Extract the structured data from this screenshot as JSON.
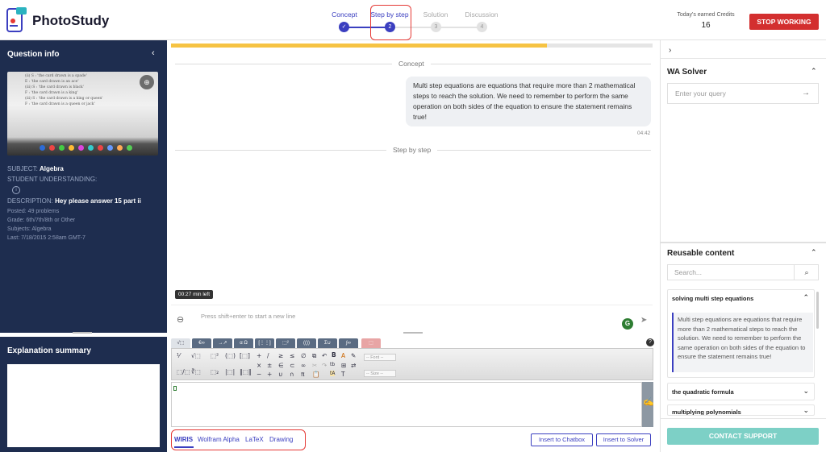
{
  "app": {
    "name": "PhotoStudy"
  },
  "steps": [
    {
      "label": "Concept",
      "state": "done",
      "icon": "check-icon"
    },
    {
      "label": "Step by step",
      "number": "2",
      "state": "active"
    },
    {
      "label": "Solution",
      "number": "3",
      "state": "pending"
    },
    {
      "label": "Discussion",
      "number": "4",
      "state": "pending"
    }
  ],
  "credits": {
    "label": "Today's earned Credits",
    "value": "16"
  },
  "stop_button": "STOP WORKING",
  "question_info": {
    "title": "Question info",
    "image_lines": [
      "(ii) S : 'the card drawn is a spade'",
      "E : 'the card drawn is an ace'",
      "(iii) S : 'the card drawn is black'",
      "F : 'the card drawn is a king'",
      "(iii) S : 'the card drawn is a king or queen'",
      "F : 'the card drawn is a queen or jack'"
    ],
    "subject_label": "SUBJECT:",
    "subject_value": "Algebra",
    "understanding_label": "STUDENT UNDERSTANDING:",
    "description_label": "DESCRIPTION:",
    "description_value": "Hey please answer 15 part ii",
    "posted": "Posted: 49 problems",
    "grade": "Grade: 6th/7th/8th or Other",
    "subjects": "Subjects: Algebra",
    "last": "Last: 7/18/2015 2:58am GMT-7"
  },
  "explanation": {
    "title": "Explanation summary"
  },
  "chat": {
    "section_concept": "Concept",
    "concept_message": "Multi step equations are equations that require more than 2 mathematical steps to reach the solution. We need to remember to perform the same operation on both sides of the equation to ensure the statement remains true!",
    "message_time": "04:42",
    "section_step": "Step by step",
    "timer": "00:27 min left",
    "input_placeholder": "Press shift+enter to start a new line",
    "progress_percent": 78
  },
  "editor": {
    "tabs": [
      "√⬚",
      "€∞",
      "→↗",
      "α Ω",
      "[⋮⋮]",
      "⬚²",
      "(())",
      "Σ∪",
      "∫∞",
      "⬚"
    ],
    "font_dropdown": "-- Font --",
    "size_dropdown": "-- Size --"
  },
  "tools": {
    "tabs": [
      "WIRIS",
      "Wolfram Alpha",
      "LaTeX",
      "Drawing"
    ],
    "insert_chatbox": "Insert to Chatbox",
    "insert_solver": "Insert to Solver"
  },
  "wa_solver": {
    "title": "WA Solver",
    "placeholder": "Enter your query"
  },
  "reusable": {
    "title": "Reusable content",
    "search_placeholder": "Search...",
    "items": [
      {
        "title": "solving multi step equations",
        "expanded": true,
        "content": "Multi step equations are equations that require more than 2 mathematical steps to reach the solution. We need to remember to perform the same operation on both sides of the equation to ensure the statement remains true!"
      },
      {
        "title": "the quadratic formula",
        "expanded": false
      },
      {
        "title": "multiplying polynomials",
        "expanded": false
      }
    ]
  },
  "contact_support": "CONTACT SUPPORT",
  "colors": {
    "accent": "#3b3fc0",
    "danger": "#d32f2f",
    "panel": "#1e2d4f",
    "progress": "#f6c343",
    "support": "#7dd0c6"
  }
}
